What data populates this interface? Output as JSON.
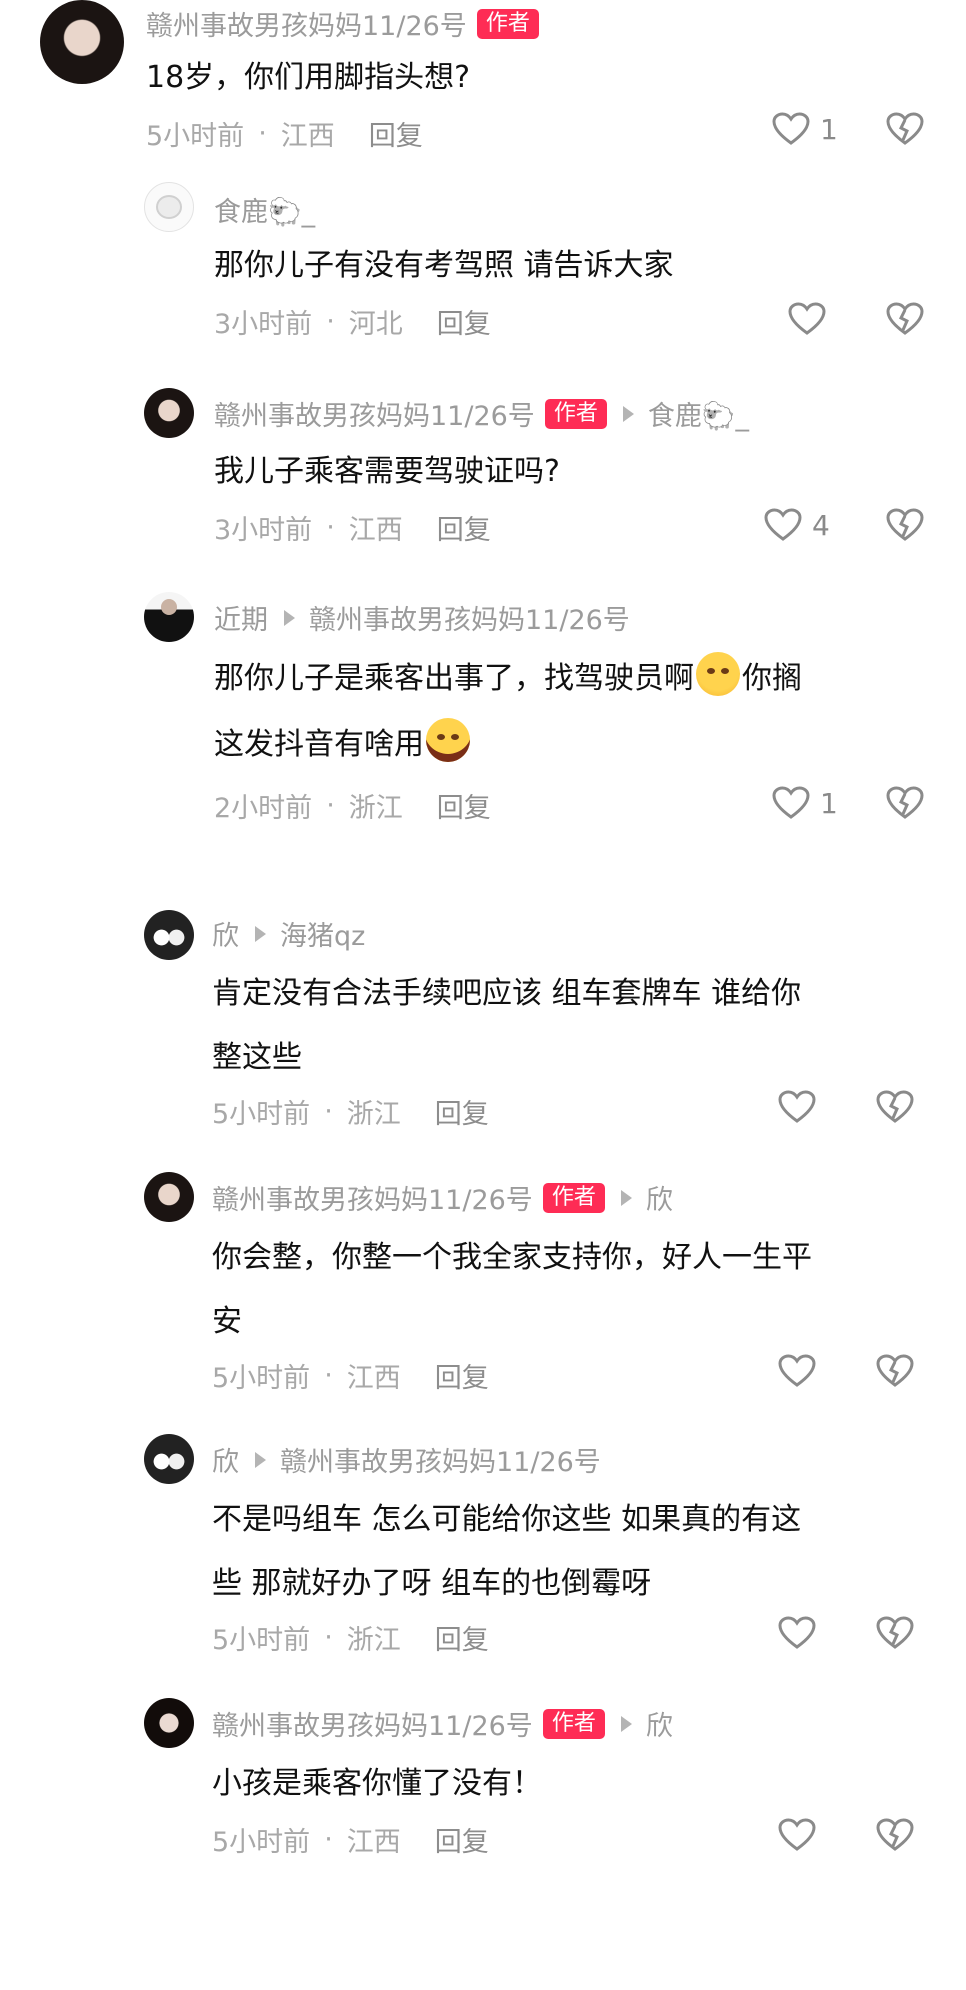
{
  "comments": [
    {
      "author": "赣州事故男孩妈妈11/26号",
      "badge": "作者",
      "text": [
        "18岁，你们用脚指头想?"
      ],
      "time": "5小时前",
      "location": "江西",
      "reply": "回复",
      "likes": "1"
    },
    {
      "author": "食鹿🐑_",
      "text": [
        "那你儿子有没有考驾照 请告诉大家"
      ],
      "time": "3小时前",
      "location": "河北",
      "reply": "回复"
    },
    {
      "author": "赣州事故男孩妈妈11/26号",
      "badge": "作者",
      "reply_to": "食鹿🐑_",
      "text": [
        "我儿子乘客需要驾驶证吗?"
      ],
      "time": "3小时前",
      "location": "江西",
      "reply": "回复",
      "likes": "4"
    },
    {
      "author": "近期",
      "reply_to": "赣州事故男孩妈妈11/26号",
      "text_a": "那你儿子是乘客出事了，找驾驶员啊",
      "text_b": "你搁",
      "text_c": "这发抖音有啥用",
      "time": "2小时前",
      "location": "浙江",
      "reply": "回复",
      "likes": "1"
    },
    {
      "author": "欣",
      "reply_to": "海猪qz",
      "text": [
        "肯定没有合法手续吧应该 组车套牌车 谁给你",
        "整这些"
      ],
      "time": "5小时前",
      "location": "浙江",
      "reply": "回复"
    },
    {
      "author": "赣州事故男孩妈妈11/26号",
      "badge": "作者",
      "reply_to": "欣",
      "text": [
        "你会整，你整一个我全家支持你，好人一生平",
        "安"
      ],
      "time": "5小时前",
      "location": "江西",
      "reply": "回复"
    },
    {
      "author": "欣",
      "reply_to": "赣州事故男孩妈妈11/26号",
      "text": [
        "不是吗组车 怎么可能给你这些 如果真的有这",
        "些 那就好办了呀 组车的也倒霉呀"
      ],
      "time": "5小时前",
      "location": "浙江",
      "reply": "回复"
    },
    {
      "author": "赣州事故男孩妈妈11/26号",
      "badge": "作者",
      "reply_to": "欣",
      "text": [
        "小孩是乘客你懂了没有！"
      ],
      "time": "5小时前",
      "location": "江西",
      "reply": "回复"
    }
  ],
  "icons": {
    "like": "heart-icon",
    "dislike": "broken-heart-icon",
    "reply_arrow": "triangle-right-icon"
  },
  "colors": {
    "badge": "#fe2c55",
    "meta": "#a8a8a8",
    "text": "#111111"
  }
}
